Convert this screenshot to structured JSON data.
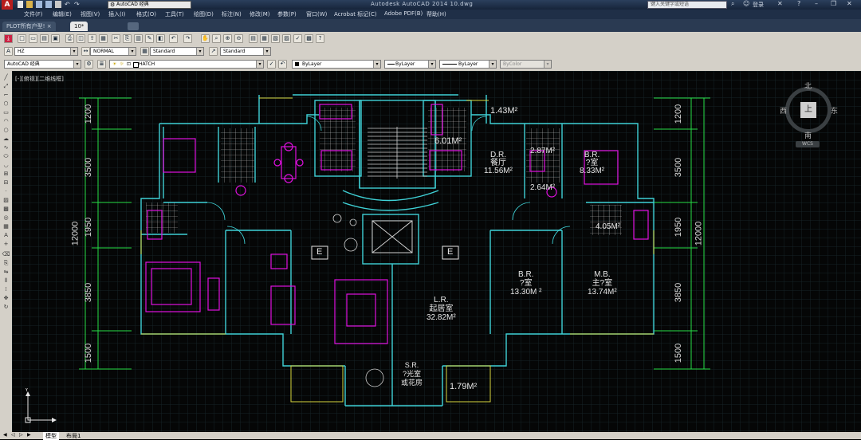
{
  "titlebar": {
    "app_quick": "AutoCAD 经典",
    "title": "Autodesk AutoCAD 2014    10.dwg",
    "search_placeholder": "键入关键字或短语",
    "login": "登录"
  },
  "menubar": {
    "items": [
      "文件(F)",
      "编辑(E)",
      "视图(V)",
      "插入(I)",
      "格式(O)",
      "工具(T)",
      "绘图(D)",
      "标注(N)",
      "修改(M)",
      "参数(P)",
      "窗口(W)",
      "Acrobat 标记(C)",
      "Adobe PDF(B)",
      "帮助(H)"
    ]
  },
  "tabs": [
    {
      "label": "PLOT所有户型!"
    },
    {
      "label": "10*"
    }
  ],
  "styles": {
    "text_style": "HZ",
    "dim_style": "NORMAL",
    "table_style": "Standard",
    "mleader_style": "Standard"
  },
  "workspace": "AutoCAD 经典",
  "layer": {
    "current": "HATCH"
  },
  "properties": {
    "color": "ByLayer",
    "linetype": "ByLayer",
    "lineweight": "ByLayer",
    "plotstyle": "ByColor"
  },
  "viewport_label": "[-][俯视][二维线框]",
  "viewcube": {
    "north": "北",
    "south": "南",
    "east": "东",
    "west": "西",
    "top": "上",
    "wcs": "WCS"
  },
  "dimensions": {
    "left_segments": [
      "1200",
      "3500",
      "1950",
      "3850",
      "1500"
    ],
    "left_total": "12000",
    "right_segments": [
      "1200",
      "3500",
      "1950",
      "3850",
      "1500"
    ],
    "right_total": "12000"
  },
  "rooms": [
    {
      "text": "1.43M²"
    },
    {
      "text": "6.01M²"
    },
    {
      "text": "D.R.\n餐厅\n11.56M²"
    },
    {
      "text": "2.87M²"
    },
    {
      "text": "B.R.\n?室\n8.33M²"
    },
    {
      "text": "2.64M²"
    },
    {
      "text": "4.05M²"
    },
    {
      "text": "B.R.\n?室\n13.30M ²"
    },
    {
      "text": "M.B.\n主?室\n13.74M²"
    },
    {
      "text": "L.R.\n起居室\n32.82M²"
    },
    {
      "text": "S.R.\n?光室\n或花房"
    },
    {
      "text": "1.79M²"
    }
  ],
  "elevator_marks": [
    "E",
    "E"
  ],
  "layout_tabs": [
    "模型",
    "布局1"
  ],
  "colors": {
    "wall": "#3fd1d6",
    "furniture": "#e010e0",
    "dim": "#27e04a",
    "window": "#d7d53e",
    "grid": "#1b2a2e"
  }
}
